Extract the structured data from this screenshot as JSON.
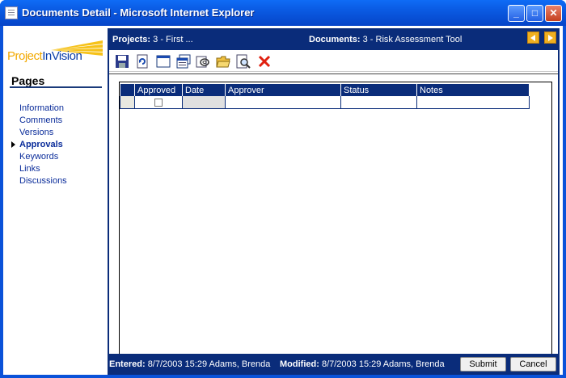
{
  "window": {
    "title": "Documents Detail - Microsoft Internet Explorer",
    "controls": {
      "minimize": "_",
      "maximize": "□",
      "close": "✕"
    }
  },
  "logo": {
    "part1": "Project",
    "part2": "InVision"
  },
  "sidebar": {
    "title": "Pages",
    "items": [
      {
        "label": "Information"
      },
      {
        "label": "Comments"
      },
      {
        "label": "Versions"
      },
      {
        "label": "Approvals"
      },
      {
        "label": "Keywords"
      },
      {
        "label": "Links"
      },
      {
        "label": "Discussions"
      }
    ]
  },
  "header": {
    "projects_label": "Projects:",
    "projects_value": "3 - First ...",
    "documents_label": "Documents:",
    "documents_value": "3 - Risk Assessment Tool"
  },
  "toolbar": {
    "icons": [
      "save-icon",
      "refresh-icon",
      "new-window-icon",
      "list-icon",
      "attach-icon",
      "open-folder-icon",
      "preview-icon",
      "delete-icon"
    ]
  },
  "grid": {
    "columns": [
      "Approved",
      "Date",
      "Approver",
      "Status",
      "Notes"
    ],
    "rows": [
      {
        "approved": false,
        "date": "",
        "approver": "",
        "status": "",
        "notes": ""
      }
    ]
  },
  "footer": {
    "entered_label": "Entered:",
    "entered_value": "8/7/2003 15:29 Adams, Brenda",
    "modified_label": "Modified:",
    "modified_value": "8/7/2003 15:29 Adams, Brenda",
    "submit_label": "Submit",
    "cancel_label": "Cancel"
  },
  "colors": {
    "accent": "#0a2c7a",
    "titlebar": "#0a5ae2",
    "link": "#0a2c9a",
    "delete": "#e02010"
  }
}
